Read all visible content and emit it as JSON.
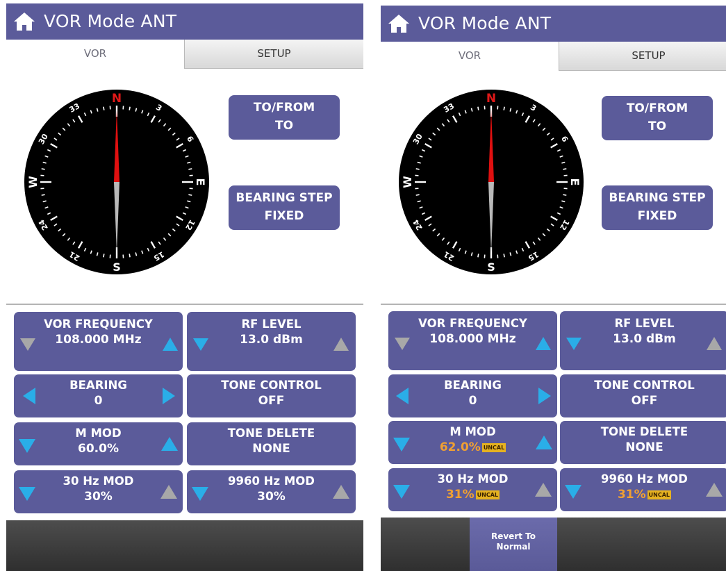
{
  "colors": {
    "title_bar": "#5b5b9a",
    "button": "#5b5b9a",
    "arrow_active": "#2aaee8",
    "arrow_inactive": "#a8a8a8",
    "uncal_text": "#f0a032",
    "needle_north": "#e01010",
    "compass_face": "#000000"
  },
  "panels": [
    {
      "title": "VOR Mode  ANT",
      "tabs": {
        "vor": "VOR",
        "setup": "SETUP"
      },
      "compass": {
        "labels": {
          "n": "N",
          "e": "E",
          "s": "S",
          "w": "W",
          "t3": "3",
          "t6": "6",
          "t12": "12",
          "t15": "15",
          "t21": "21",
          "t24": "24",
          "t30": "30",
          "t33": "33"
        },
        "heading_deg": 0
      },
      "to_from": {
        "label": "TO/FROM",
        "value": "TO"
      },
      "bearing_step": {
        "label": "BEARING STEP",
        "value": "FIXED"
      },
      "controls": {
        "vor_frequency": {
          "label": "VOR FREQUENCY",
          "value": "108.000 MHz"
        },
        "rf_level": {
          "label": "RF LEVEL",
          "value": "13.0 dBm"
        },
        "bearing": {
          "label": "BEARING",
          "value": "0"
        },
        "tone_control": {
          "label": "TONE CONTROL",
          "value": "OFF"
        },
        "m_mod": {
          "label": "M MOD",
          "value": "60.0%"
        },
        "tone_delete": {
          "label": "TONE DELETE",
          "value": "NONE"
        },
        "mod_30hz": {
          "label": "30 Hz MOD",
          "value": "30%"
        },
        "mod_9960hz": {
          "label": "9960 Hz MOD",
          "value": "30%"
        }
      }
    },
    {
      "title": "VOR Mode  ANT",
      "tabs": {
        "vor": "VOR",
        "setup": "SETUP"
      },
      "compass": {
        "labels": {
          "n": "N",
          "e": "E",
          "s": "S",
          "w": "W",
          "t3": "3",
          "t6": "6",
          "t12": "12",
          "t15": "15",
          "t21": "21",
          "t24": "24",
          "t30": "30",
          "t33": "33"
        },
        "heading_deg": 0
      },
      "to_from": {
        "label": "TO/FROM",
        "value": "TO"
      },
      "bearing_step": {
        "label": "BEARING STEP",
        "value": "FIXED"
      },
      "controls": {
        "vor_frequency": {
          "label": "VOR FREQUENCY",
          "value": "108.000 MHz"
        },
        "rf_level": {
          "label": "RF LEVEL",
          "value": "13.0 dBm"
        },
        "bearing": {
          "label": "BEARING",
          "value": "0"
        },
        "tone_control": {
          "label": "TONE CONTROL",
          "value": "OFF"
        },
        "m_mod": {
          "label": "M MOD",
          "value": "62.0%",
          "badge": "UNCAL"
        },
        "tone_delete": {
          "label": "TONE DELETE",
          "value": "NONE"
        },
        "mod_30hz": {
          "label": "30 Hz MOD",
          "value": "31%",
          "badge": "UNCAL"
        },
        "mod_9960hz": {
          "label": "9960 Hz MOD",
          "value": "31%",
          "badge": "UNCAL"
        }
      },
      "revert_button": {
        "line1": "Revert To",
        "line2": "Normal"
      }
    }
  ]
}
